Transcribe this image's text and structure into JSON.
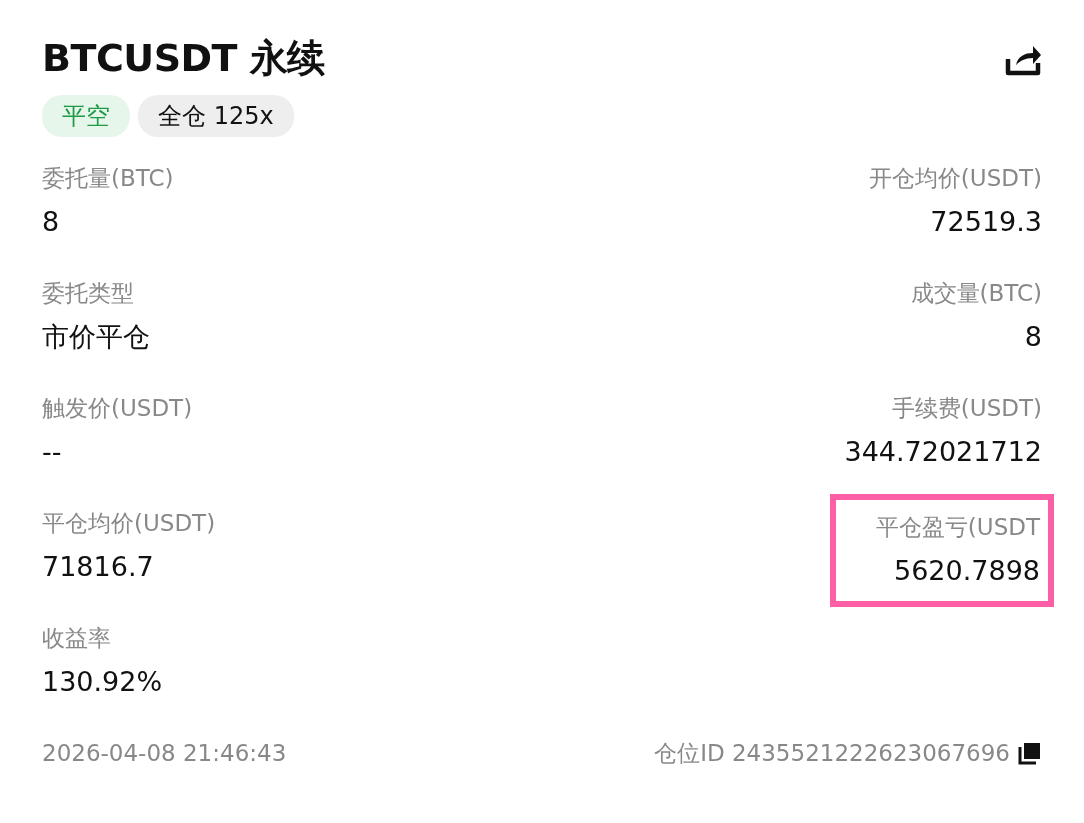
{
  "title": "BTCUSDT 永续",
  "tags": [
    {
      "text": "平空",
      "kind": "side"
    },
    {
      "text": "全仓 125x",
      "kind": "margin"
    }
  ],
  "fields_left": [
    {
      "label": "委托量(BTC)",
      "value": "8",
      "highlighted": false
    },
    {
      "label": "委托类型",
      "value": "市价平仓",
      "highlighted": false
    },
    {
      "label": "触发价(USDT)",
      "value": "--",
      "highlighted": false
    },
    {
      "label": "平仓均价(USDT)",
      "value": "71816.7",
      "highlighted": false
    },
    {
      "label": "收益率",
      "value": "130.92%",
      "highlighted": false
    }
  ],
  "fields_right": [
    {
      "label": "开仓均价(USDT)",
      "value": "72519.3",
      "highlighted": false
    },
    {
      "label": "成交量(BTC)",
      "value": "8",
      "highlighted": false
    },
    {
      "label": "手续费(USDT)",
      "value": "344.72021712",
      "highlighted": false
    },
    {
      "label": "平仓盈亏(USDT",
      "value": "5620.7898",
      "highlighted": true
    }
  ],
  "footer": {
    "time": "2026-04-08 21:46:43",
    "position_id": "仓位ID 2435521222623067696"
  }
}
